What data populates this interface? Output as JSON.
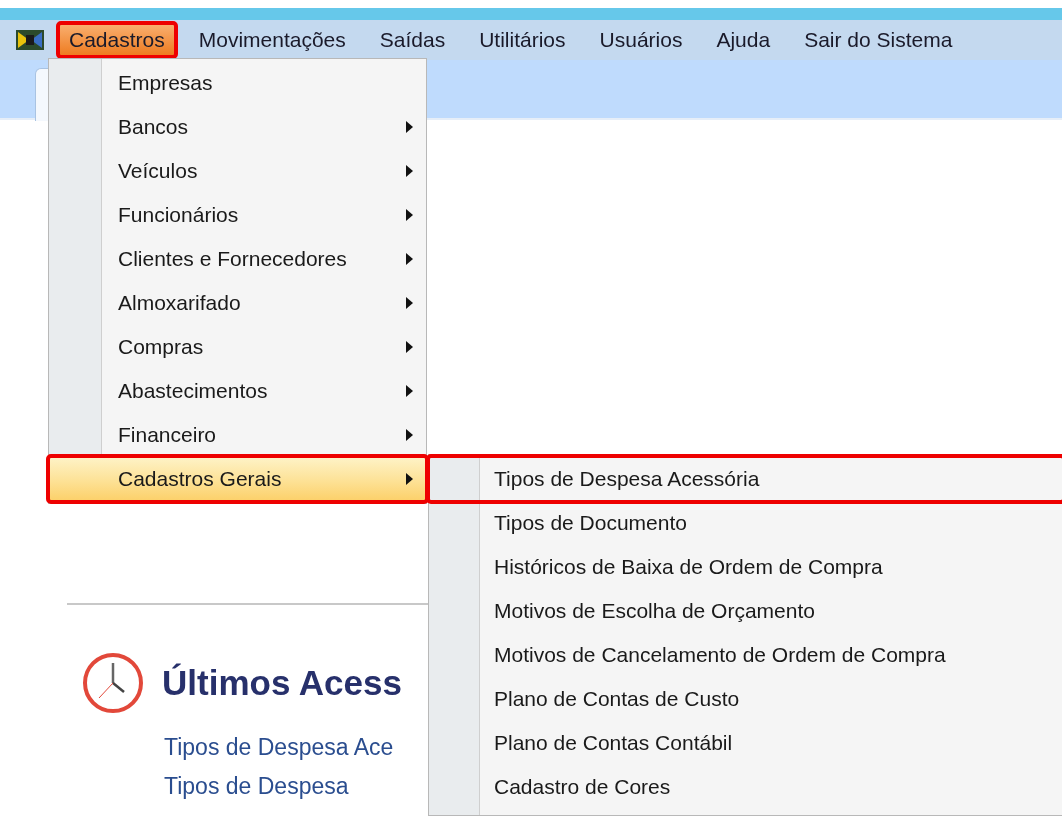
{
  "menubar": [
    {
      "label": "Cadastros",
      "selected": true,
      "annotated": true
    },
    {
      "label": "Movimentações",
      "selected": false,
      "annotated": false
    },
    {
      "label": "Saídas",
      "selected": false,
      "annotated": false
    },
    {
      "label": "Utilitários",
      "selected": false,
      "annotated": false
    },
    {
      "label": "Usuários",
      "selected": false,
      "annotated": false
    },
    {
      "label": "Ajuda",
      "selected": false,
      "annotated": false
    },
    {
      "label": "Sair do Sistema",
      "selected": false,
      "annotated": false
    }
  ],
  "menu": [
    {
      "label": "Empresas",
      "has_submenu": false,
      "selected": false,
      "annotated": false
    },
    {
      "label": "Bancos",
      "has_submenu": true,
      "selected": false,
      "annotated": false
    },
    {
      "label": "Veículos",
      "has_submenu": true,
      "selected": false,
      "annotated": false
    },
    {
      "label": "Funcionários",
      "has_submenu": true,
      "selected": false,
      "annotated": false
    },
    {
      "label": "Clientes e Fornecedores",
      "has_submenu": true,
      "selected": false,
      "annotated": false
    },
    {
      "label": "Almoxarifado",
      "has_submenu": true,
      "selected": false,
      "annotated": false
    },
    {
      "label": "Compras",
      "has_submenu": true,
      "selected": false,
      "annotated": false
    },
    {
      "label": "Abastecimentos",
      "has_submenu": true,
      "selected": false,
      "annotated": false
    },
    {
      "label": "Financeiro",
      "has_submenu": true,
      "selected": false,
      "annotated": false
    },
    {
      "label": "Cadastros Gerais",
      "has_submenu": true,
      "selected": true,
      "annotated": true
    }
  ],
  "submenu": [
    {
      "label": "Tipos de Despesa Acessória",
      "selected": false,
      "annotated": true
    },
    {
      "label": "Tipos de Documento",
      "selected": false,
      "annotated": false
    },
    {
      "label": "Históricos de Baixa de Ordem de Compra",
      "selected": false,
      "annotated": false
    },
    {
      "label": "Motivos de Escolha de Orçamento",
      "selected": false,
      "annotated": false
    },
    {
      "label": "Motivos de Cancelamento de Ordem de Compra",
      "selected": false,
      "annotated": false
    },
    {
      "label": "Plano de Contas de Custo",
      "selected": false,
      "annotated": false
    },
    {
      "label": "Plano de Contas Contábil",
      "selected": false,
      "annotated": false
    },
    {
      "label": "Cadastro de Cores",
      "selected": false,
      "annotated": false
    }
  ],
  "recent": {
    "title": "Últimos Acess",
    "links": [
      "Tipos de Despesa Ace",
      "Tipos de Despesa"
    ]
  }
}
